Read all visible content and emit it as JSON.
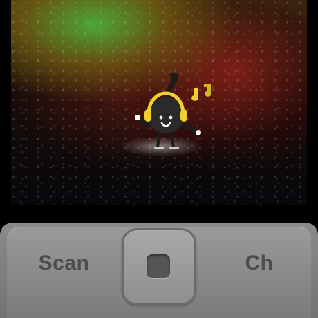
{
  "softkeys": {
    "left_label": "Scan",
    "right_label": "Ch"
  },
  "icons": {
    "mascot": "music-note-mascot-with-headphones-icon",
    "notes": "music-notes-icon",
    "dpad": "dpad-icon",
    "select": "select-key-icon"
  },
  "colors": {
    "headphones": "#f0d12b",
    "notes": "#d9c11f",
    "panel": "#7f7f7f",
    "label": "#4c4c4c"
  }
}
